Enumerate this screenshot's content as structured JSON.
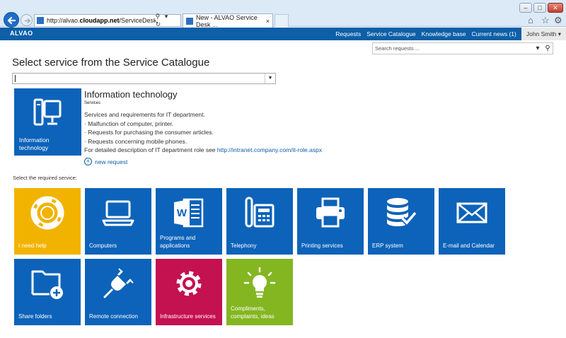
{
  "browser": {
    "url_prefix": "http://alvao.",
    "url_domain": "cloudapp.net",
    "url_rest": "/ServiceDesk/NewTick",
    "url_tools": "⚲ ▾ ↻",
    "tab_title": "New - ALVAO Service Desk ...",
    "tab_close": "×"
  },
  "header": {
    "logo": "ALVAO",
    "nav": [
      "Requests",
      "Service Catalogue",
      "Knowledge base",
      "Current news (1)"
    ],
    "user": "John Smith ▾"
  },
  "search": {
    "placeholder": "Search requests ..."
  },
  "page": {
    "title": "Select service from the Service Catalogue",
    "select_required_label": "Select the required service:"
  },
  "category": {
    "tile_label_1": "Information",
    "tile_label_2": "technology",
    "title": "Information technology",
    "subtitle": "Services",
    "desc_lines": [
      "Services and requirements for IT department.",
      "· Malfunction of computer, printer.",
      "· Requests for purchasing the consumer articles.",
      "· Requests concerning mobile phones."
    ],
    "desc_link_prefix": "For detailed description of IT department role see ",
    "desc_link": "http://intranet.company.com/it-role.aspx",
    "new_request": "new request"
  },
  "tiles": [
    {
      "label": "I need help",
      "color": "#f2b300",
      "icon": "lifebuoy-icon"
    },
    {
      "label": "Computers",
      "color": "#0d63b9",
      "icon": "laptop-icon"
    },
    {
      "label": "Programs and applications",
      "color": "#0d63b9",
      "icon": "word-document-icon"
    },
    {
      "label": "Telephony",
      "color": "#0d63b9",
      "icon": "desk-phone-icon"
    },
    {
      "label": "Printing services",
      "color": "#0d63b9",
      "icon": "printer-icon"
    },
    {
      "label": "ERP system",
      "color": "#0d63b9",
      "icon": "database-check-icon"
    },
    {
      "label": "E-mail and Calendar",
      "color": "#0d63b9",
      "icon": "envelope-icon"
    },
    {
      "label": "Share folders",
      "color": "#0d63b9",
      "icon": "folder-add-icon"
    },
    {
      "label": "Remote connection",
      "color": "#0d63b9",
      "icon": "plug-icon"
    },
    {
      "label": "Infrastructure services",
      "color": "#c4114f",
      "icon": "cog-icon"
    },
    {
      "label": "Compliments, complaints, ideas",
      "color": "#84b621",
      "icon": "lightbulb-icon"
    }
  ]
}
